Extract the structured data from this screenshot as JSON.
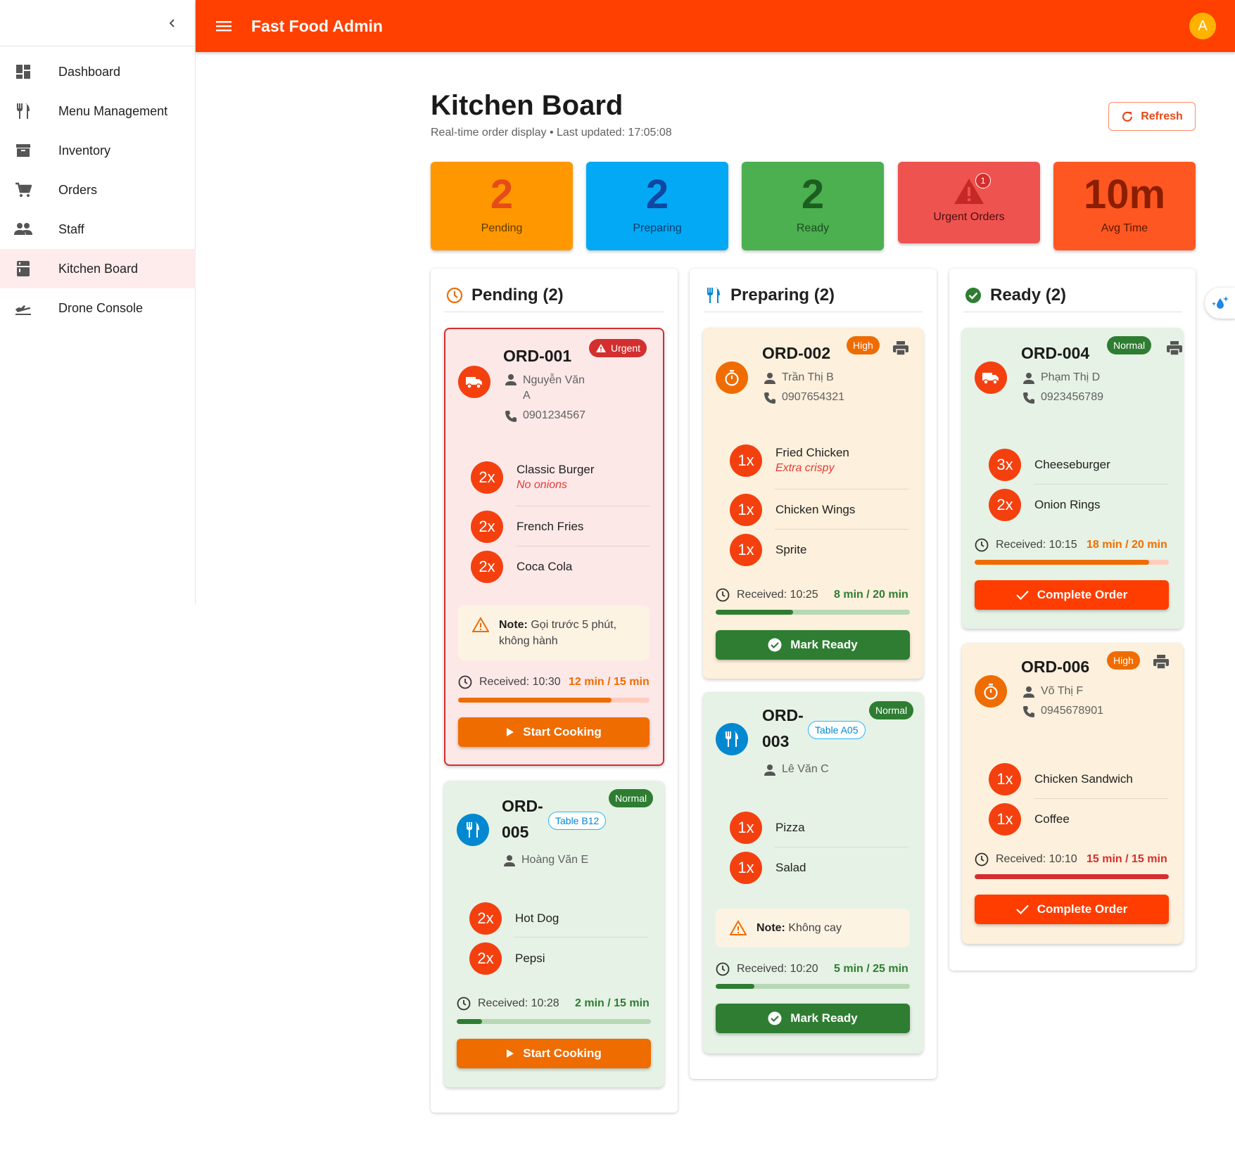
{
  "app": {
    "title": "Fast Food Admin",
    "avatar_letter": "A"
  },
  "sidebar": {
    "items": [
      {
        "label": "Dashboard",
        "icon": "dashboard-icon"
      },
      {
        "label": "Menu Management",
        "icon": "restaurant-icon"
      },
      {
        "label": "Inventory",
        "icon": "inventory-icon"
      },
      {
        "label": "Orders",
        "icon": "cart-icon"
      },
      {
        "label": "Staff",
        "icon": "people-icon"
      },
      {
        "label": "Kitchen Board",
        "icon": "kitchen-icon",
        "active": true
      },
      {
        "label": "Drone Console",
        "icon": "flight-icon"
      }
    ]
  },
  "header": {
    "title": "Kitchen Board",
    "subtitle": "Real-time order display • Last updated: 17:05:08",
    "refresh_label": "Refresh"
  },
  "stats": {
    "pending": {
      "value": "2",
      "label": "Pending"
    },
    "preparing": {
      "value": "2",
      "label": "Preparing"
    },
    "ready": {
      "value": "2",
      "label": "Ready"
    },
    "urgent": {
      "badge": "1",
      "label": "Urgent Orders"
    },
    "avg": {
      "value": "10m",
      "label": "Avg Time"
    }
  },
  "columns": {
    "pending": {
      "title": "Pending (2)"
    },
    "preparing": {
      "title": "Preparing (2)"
    },
    "ready": {
      "title": "Ready (2)"
    }
  },
  "orders": {
    "o001": {
      "id": "ORD-001",
      "priority": "Urgent",
      "customer_line1": "Nguyễn Văn",
      "customer_line2": "A",
      "phone": "0901234567",
      "items": [
        {
          "qty": "2x",
          "name": "Classic Burger",
          "note": "No onions"
        },
        {
          "qty": "2x",
          "name": "French Fries"
        },
        {
          "qty": "2x",
          "name": "Coca Cola"
        }
      ],
      "note_label": "Note:",
      "note_text": "Gọi trước 5 phút, không hành",
      "received": "Received: 10:30",
      "elapsed": "12 min / 15 min",
      "progress": 0.8,
      "action": "Start Cooking"
    },
    "o005": {
      "id_line1": "ORD-",
      "id_line2": "005",
      "priority": "Normal",
      "table": "Table B12",
      "customer": "Hoàng Văn E",
      "items": [
        {
          "qty": "2x",
          "name": "Hot Dog"
        },
        {
          "qty": "2x",
          "name": "Pepsi"
        }
      ],
      "received": "Received: 10:28",
      "elapsed": "2 min / 15 min",
      "progress": 0.13,
      "action": "Start Cooking"
    },
    "o002": {
      "id": "ORD-002",
      "priority": "High",
      "customer": "Trần Thị B",
      "phone": "0907654321",
      "items": [
        {
          "qty": "1x",
          "name": "Fried Chicken",
          "note": "Extra crispy"
        },
        {
          "qty": "1x",
          "name": "Chicken Wings"
        },
        {
          "qty": "1x",
          "name": "Sprite"
        }
      ],
      "received": "Received: 10:25",
      "elapsed": "8 min / 20 min",
      "progress": 0.4,
      "action": "Mark Ready"
    },
    "o003": {
      "id_line1": "ORD-",
      "id_line2": "003",
      "priority": "Normal",
      "table": "Table A05",
      "customer": "Lê Văn C",
      "items": [
        {
          "qty": "1x",
          "name": "Pizza"
        },
        {
          "qty": "1x",
          "name": "Salad"
        }
      ],
      "note_label": "Note:",
      "note_text": "Không cay",
      "received": "Received: 10:20",
      "elapsed": "5 min / 25 min",
      "progress": 0.2,
      "action": "Mark Ready"
    },
    "o004": {
      "id": "ORD-004",
      "priority": "Normal",
      "customer": "Phạm Thị D",
      "phone": "0923456789",
      "items": [
        {
          "qty": "3x",
          "name": "Cheeseburger"
        },
        {
          "qty": "2x",
          "name": "Onion Rings"
        }
      ],
      "received": "Received: 10:15",
      "elapsed": "18 min / 20 min",
      "progress": 0.9,
      "action": "Complete Order"
    },
    "o006": {
      "id": "ORD-006",
      "priority": "High",
      "customer": "Võ Thị F",
      "phone": "0945678901",
      "items": [
        {
          "qty": "1x",
          "name": "Chicken Sandwich"
        },
        {
          "qty": "1x",
          "name": "Coffee"
        }
      ],
      "received": "Received: 10:10",
      "elapsed": "15 min / 15 min",
      "progress": 1.0,
      "action": "Complete Order"
    }
  },
  "colors": {
    "brand": "#ff4000",
    "pending": "#ff9800",
    "preparing": "#03a9f4",
    "ready": "#4caf50",
    "urgent": "#ef5350",
    "avg": "#ff5722"
  }
}
